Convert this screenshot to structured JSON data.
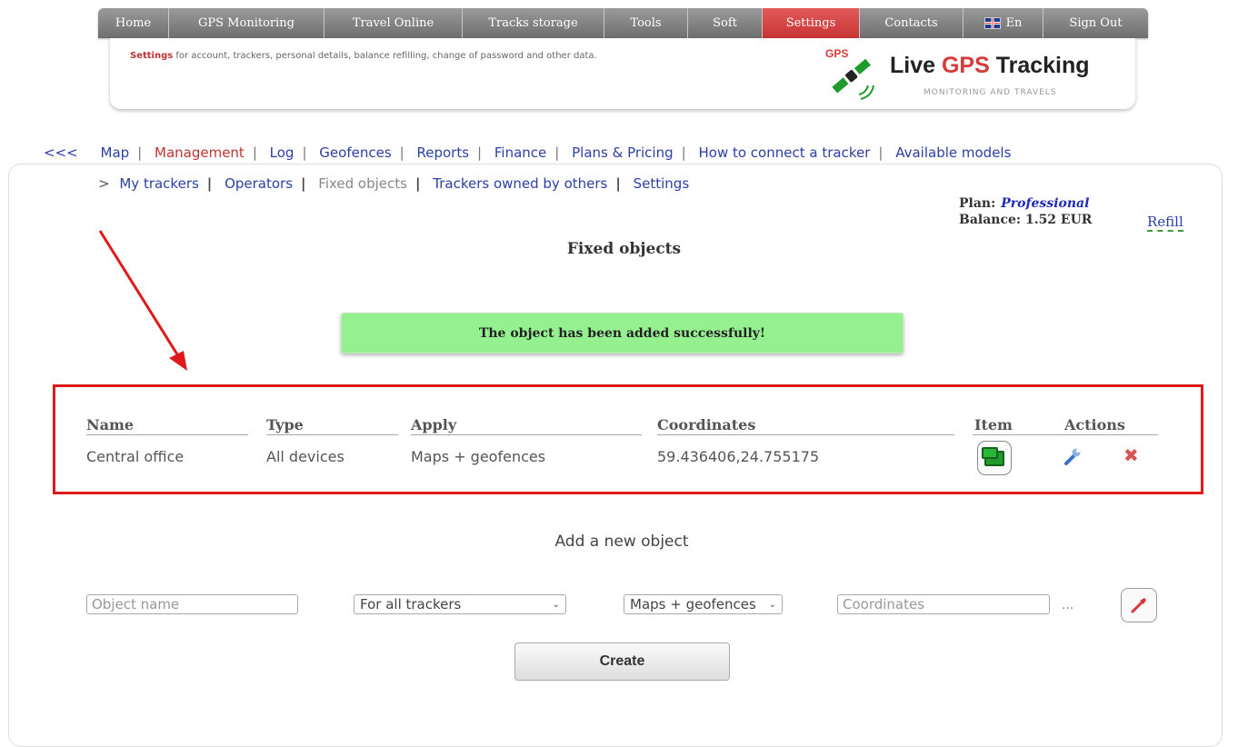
{
  "topnav": [
    {
      "label": "Home"
    },
    {
      "label": "GPS Monitoring"
    },
    {
      "label": "Travel Online"
    },
    {
      "label": "Tracks storage"
    },
    {
      "label": "Tools"
    },
    {
      "label": "Soft"
    },
    {
      "label": "Settings",
      "active": true
    },
    {
      "label": "Contacts"
    },
    {
      "label": "En",
      "icon": "uk-flag-icon"
    },
    {
      "label": "Sign Out"
    }
  ],
  "banner": {
    "settings_word": "Settings",
    "description": " for account, trackers, personal details, balance refilling, change of password and other data.",
    "logo_badge": "GPS",
    "logo_title_1": "Live ",
    "logo_title_2": "GPS",
    "logo_title_3": " Tracking",
    "logo_subtitle": "MONITORING AND TRAVELS"
  },
  "mainlinks": {
    "back": "<<<",
    "items": [
      "Map",
      "Management",
      "Log",
      "Geofences",
      "Reports",
      "Finance",
      "Plans & Pricing",
      "How to connect a tracker",
      "Available models"
    ],
    "separator": "|"
  },
  "sublinks": {
    "prefix": ">",
    "items": [
      "My trackers",
      "Operators",
      "Fixed objects",
      "Trackers owned by others",
      "Settings"
    ],
    "separator": "|"
  },
  "account": {
    "plan_label": "Plan:",
    "plan_value": "Professional",
    "balance_label": "Balance:",
    "balance_value": "1.52 EUR",
    "refill": "Refill"
  },
  "page_title": "Fixed objects",
  "success_message": "The object has been added successfully!",
  "table": {
    "headers": {
      "name": "Name",
      "type": "Type",
      "apply": "Apply",
      "coordinates": "Coordinates",
      "item": "Item",
      "actions": "Actions"
    },
    "rows": [
      {
        "name": "Central office",
        "type": "All devices",
        "apply": "Maps + geofences",
        "coordinates": "59.436406,24.755175"
      }
    ]
  },
  "add_form": {
    "title": "Add a new object",
    "name_placeholder": "Object name",
    "trackers_selected": "For all trackers",
    "apply_selected": "Maps + geofences",
    "coordinates_placeholder": "Coordinates",
    "dots": "...",
    "create_label": "Create"
  },
  "colors": {
    "accent_red": "#c83434",
    "link_blue": "#2c3fa8",
    "success_green": "#95f08f",
    "annotation_red": "#e01a1a"
  }
}
